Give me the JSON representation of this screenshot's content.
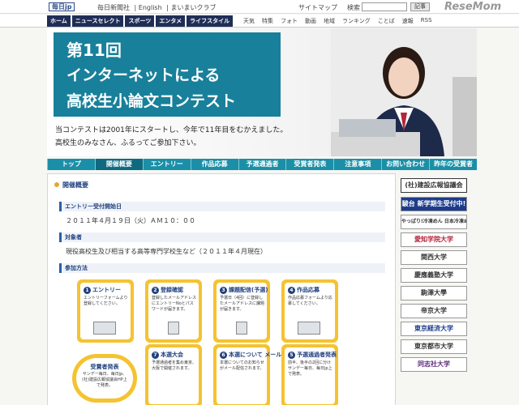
{
  "topbar": {
    "logo": "毎日jp",
    "links": [
      "毎日新聞社",
      "| English",
      "| まいまいクラブ"
    ],
    "sitemap": "サイトマップ",
    "search_label": "検索",
    "search_button": "記事",
    "watermark": "ReseMom"
  },
  "mainnav": [
    "ホーム",
    "ニュースセレクト",
    "スポーツ",
    "エンタメ",
    "ライフスタイル"
  ],
  "subnav": [
    "天気",
    "特集",
    "フォト",
    "動画",
    "地域",
    "ランキング",
    "ことば",
    "速報",
    "RSS"
  ],
  "hero": {
    "title_line1": "第11回",
    "title_line2": "インターネットによる",
    "title_line3": "高校生小論文コンテスト",
    "desc_line1": "当コンテストは2001年にスタートし、今年で11年目をむかえました。",
    "desc_line2": "高校生のみなさん、ふるってご参加下さい。"
  },
  "tabs": [
    {
      "label": "トップ",
      "active": false
    },
    {
      "label": "開催概要",
      "active": true
    },
    {
      "label": "エントリー",
      "active": false
    },
    {
      "label": "作品応募",
      "active": false
    },
    {
      "label": "予選通過者",
      "active": false
    },
    {
      "label": "受賞者発表",
      "active": false
    },
    {
      "label": "注意事項",
      "active": false
    },
    {
      "label": "お問い合わせ",
      "active": false
    },
    {
      "label": "昨年の受賞者",
      "active": false
    }
  ],
  "content": {
    "section_title": "開催概要",
    "entry_head": "エントリー受付開始日",
    "entry_date": "２０１１年４月１９日（火）ＡＭ１０：００",
    "target_head": "対象者",
    "target_text": "現役高校生及び相当する高等専門学校生など（２０１１年４月現在）",
    "method_head": "参加方法",
    "steps": [
      {
        "num": "1",
        "title": "エントリー",
        "desc": "エントリーフォームより登録してください。"
      },
      {
        "num": "2",
        "title": "登録確認",
        "desc": "登録したメールアドレスにエントリーNoとパスワードが届きます。"
      },
      {
        "num": "3",
        "title": "課題配信(予選)",
        "desc": "予選日（4回）に登録したメールアドレスに課題が届きます。"
      },
      {
        "num": "4",
        "title": "作品応募",
        "desc": "作品応募フォームより応募してください。"
      }
    ],
    "lower": [
      {
        "title": "受賞者発表",
        "desc": "サンデー毎日、毎日jp、(社)建設広報協議会HP上で発表。"
      },
      {
        "num": "7",
        "title": "本選大会",
        "desc": "予選通過者を集め東京、大阪で開催されます。"
      },
      {
        "num": "6",
        "title": "本選について メール連絡",
        "desc": "本選についてのお知らせがメール配信されます。"
      },
      {
        "num": "5",
        "title": "予選通過者発表",
        "desc": "前半、後半の2回に分けサンデー毎日、毎日jp上で発表。"
      }
    ]
  },
  "sidebar": {
    "head": "(社)建設広報協議会",
    "sponsors": [
      "駿台 新学期生受付中!",
      "やっぱり!冷凍めん 日本冷凍めん協会",
      "愛知学院大学",
      "関西大学",
      "慶應義塾大学",
      "駒澤大學",
      "帝京大学",
      "東京経済大学",
      "東京都市大学",
      "同志社大学"
    ]
  },
  "colors": {
    "navy": "#1f2e57",
    "teal": "#18809a",
    "gold": "#f5c330"
  }
}
